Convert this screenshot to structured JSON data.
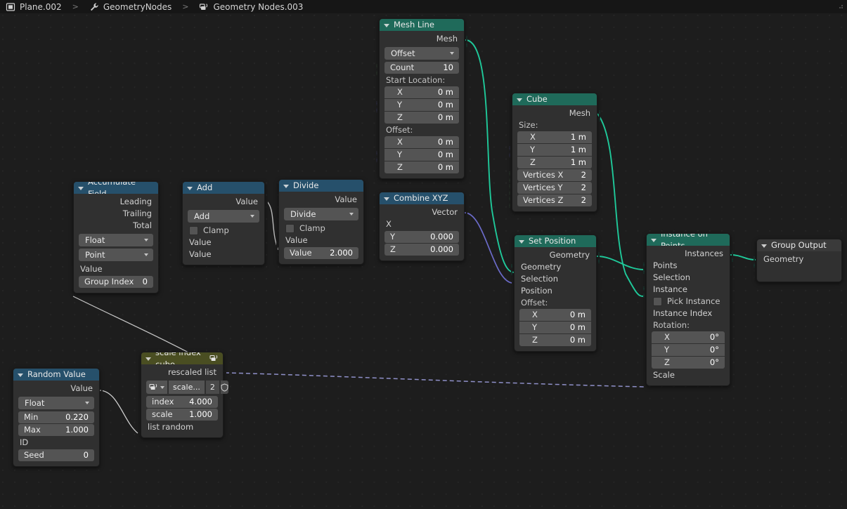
{
  "breadcrumb": {
    "items": [
      {
        "icon": "object-data-icon",
        "label": "Plane.002"
      },
      {
        "icon": "modifier-wrench-icon",
        "label": "GeometryNodes"
      },
      {
        "icon": "node-group-icon",
        "label": "Geometry Nodes.003"
      }
    ],
    "separator": ">"
  },
  "colors": {
    "geometry_header": "#1f6a5a",
    "converter_header": "#26506b",
    "group_header": "#4a4e22",
    "output_header": "#3a3a3a",
    "socket_geometry": "#00d6a3",
    "socket_vector": "#6363c7",
    "socket_value": "#a1a1a1",
    "socket_int": "#598c5c",
    "socket_boolean": "#cca6d6",
    "canvas": "#1d1d1d"
  },
  "nodes": {
    "mesh_line": {
      "title": "Mesh Line",
      "output_mesh": "Mesh",
      "mode": "Offset",
      "count_label": "Count",
      "count_value": "10",
      "start_location_label": "Start Location:",
      "start_x_label": "X",
      "start_x_value": "0 m",
      "start_y_label": "Y",
      "start_y_value": "0 m",
      "start_z_label": "Z",
      "start_z_value": "0 m",
      "offset_label": "Offset:",
      "offset_x_label": "X",
      "offset_x_value": "0 m",
      "offset_y_label": "Y",
      "offset_y_value": "0 m",
      "offset_z_label": "Z",
      "offset_z_value": "0 m"
    },
    "cube": {
      "title": "Cube",
      "output_mesh": "Mesh",
      "size_label": "Size:",
      "size_x_label": "X",
      "size_x_value": "1 m",
      "size_y_label": "Y",
      "size_y_value": "1 m",
      "size_z_label": "Z",
      "size_z_value": "1 m",
      "vx_label": "Vertices X",
      "vx_value": "2",
      "vy_label": "Vertices Y",
      "vy_value": "2",
      "vz_label": "Vertices Z",
      "vz_value": "2"
    },
    "accumulate_field": {
      "title": "Accumulate Field",
      "out_leading": "Leading",
      "out_trailing": "Trailing",
      "out_total": "Total",
      "data_type": "Float",
      "domain": "Point",
      "in_value": "Value",
      "group_index_label": "Group Index",
      "group_index_value": "0"
    },
    "add": {
      "title": "Add",
      "out_value": "Value",
      "operation": "Add",
      "clamp_label": "Clamp",
      "in_value_1": "Value",
      "in_value_2": "Value"
    },
    "divide": {
      "title": "Divide",
      "out_value": "Value",
      "operation": "Divide",
      "clamp_label": "Clamp",
      "in_value_1": "Value",
      "in_value_2_label": "Value",
      "in_value_2_value": "2.000"
    },
    "combine_xyz": {
      "title": "Combine XYZ",
      "out_vector": "Vector",
      "in_x": "X",
      "y_label": "Y",
      "y_value": "0.000",
      "z_label": "Z",
      "z_value": "0.000"
    },
    "set_position": {
      "title": "Set Position",
      "out_geometry": "Geometry",
      "in_geometry": "Geometry",
      "in_selection": "Selection",
      "in_position": "Position",
      "offset_label": "Offset:",
      "offset_x_label": "X",
      "offset_x_value": "0 m",
      "offset_y_label": "Y",
      "offset_y_value": "0 m",
      "offset_z_label": "Z",
      "offset_z_value": "0 m"
    },
    "instance_on_points": {
      "title": "Instance on Points",
      "out_instances": "Instances",
      "in_points": "Points",
      "in_selection": "Selection",
      "in_instance": "Instance",
      "pick_instance_label": "Pick Instance",
      "in_instance_index": "Instance Index",
      "rotation_label": "Rotation:",
      "rot_x_label": "X",
      "rot_x_value": "0°",
      "rot_y_label": "Y",
      "rot_y_value": "0°",
      "rot_z_label": "Z",
      "rot_z_value": "0°",
      "in_scale": "Scale"
    },
    "group_output": {
      "title": "Group Output",
      "in_geometry": "Geometry"
    },
    "scale_index_cube": {
      "title": "scale index cube",
      "out_rescaled_list": "rescaled  list",
      "group_name": "scale...",
      "group_users": "2",
      "index_label": "index",
      "index_value": "4.000",
      "scale_label": "scale",
      "scale_value": "1.000",
      "in_list_random": "list random"
    },
    "random_value": {
      "title": "Random Value",
      "out_value": "Value",
      "data_type": "Float",
      "min_label": "Min",
      "min_value": "0.220",
      "max_label": "Max",
      "max_value": "1.000",
      "in_id": "ID",
      "seed_label": "Seed",
      "seed_value": "0"
    }
  }
}
